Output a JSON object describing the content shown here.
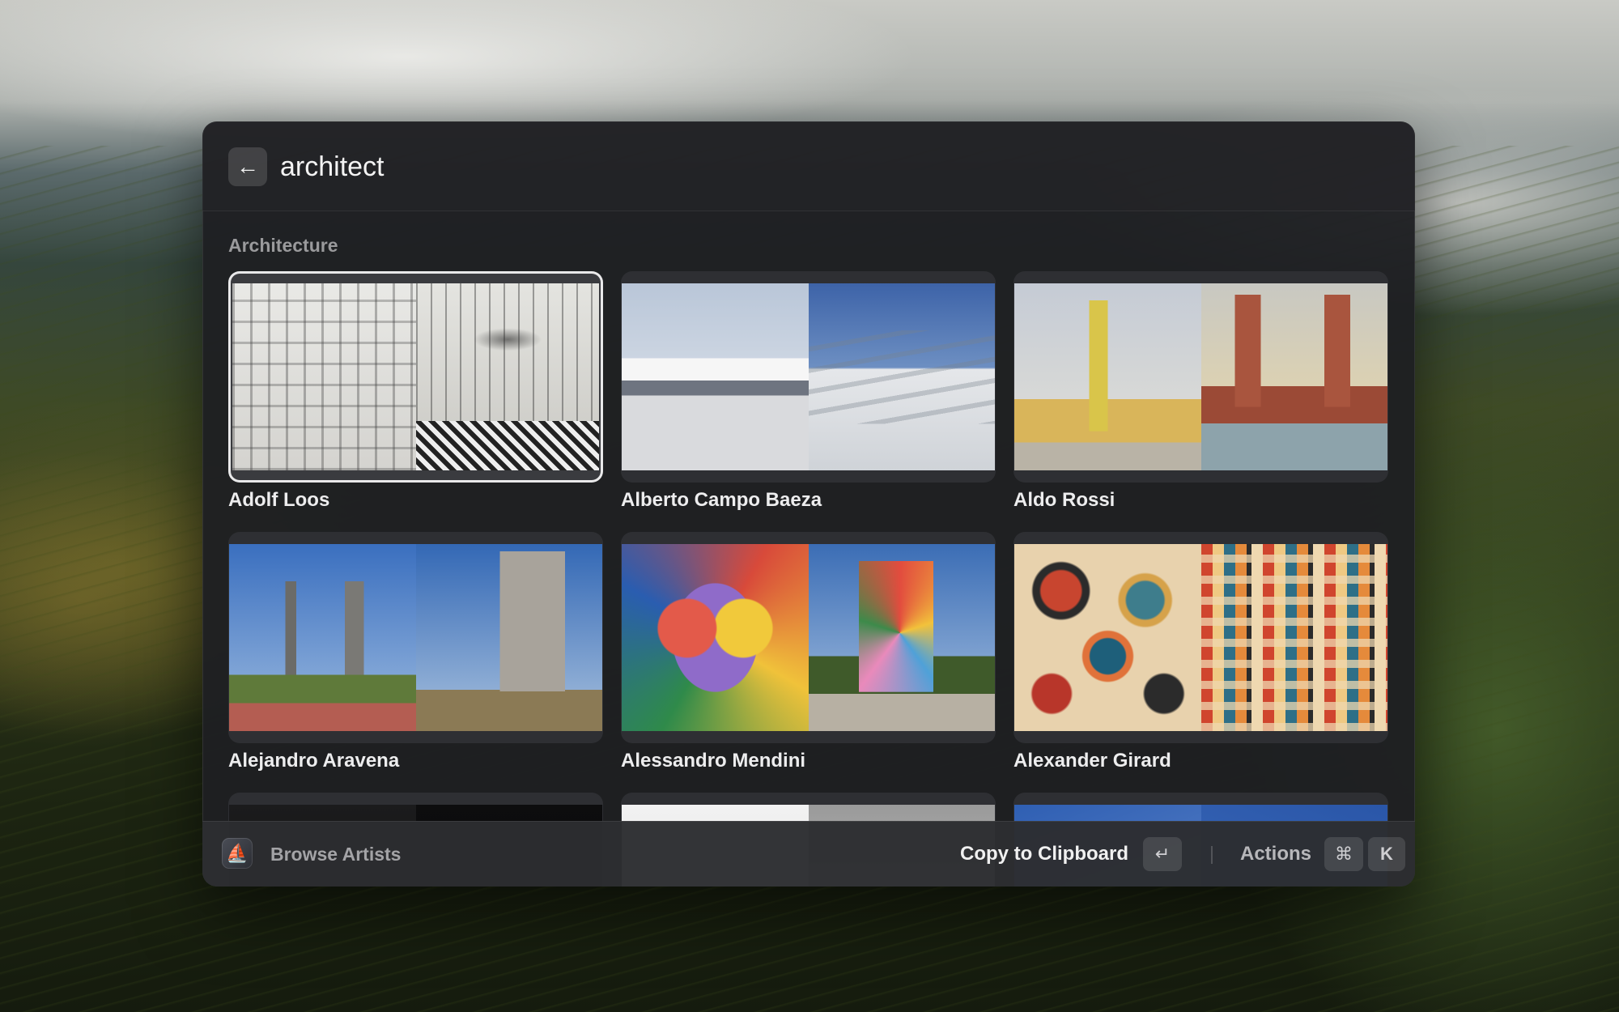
{
  "search": {
    "query": "architect"
  },
  "section": {
    "title": "Architecture"
  },
  "artists": [
    {
      "name": "Adolf Loos",
      "selected": true
    },
    {
      "name": "Alberto Campo Baeza",
      "selected": false
    },
    {
      "name": "Aldo Rossi",
      "selected": false
    },
    {
      "name": "Alejandro Aravena",
      "selected": false
    },
    {
      "name": "Alessandro Mendini",
      "selected": false
    },
    {
      "name": "Alexander Girard",
      "selected": false
    }
  ],
  "footer": {
    "title": "Browse Artists",
    "primary_action": "Copy to Clipboard",
    "primary_shortcut": "↵",
    "actions_label": "Actions",
    "actions_shortcut_modifier": "⌘",
    "actions_shortcut_key": "K"
  },
  "icons": {
    "back": "arrow-left-icon",
    "app": "sailboat-icon"
  },
  "colors": {
    "window_bg": "#1e1f22",
    "selected_outline": "#e9e9ea",
    "section_title": "#9a9a9c"
  }
}
